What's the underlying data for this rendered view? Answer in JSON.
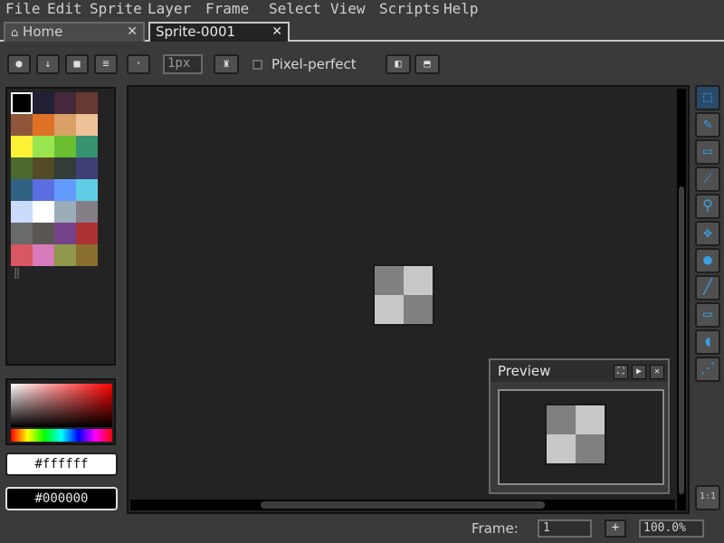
{
  "menu": [
    "File",
    "Edit",
    "Sprite",
    "Layer",
    "Frame",
    "Select",
    "View",
    "Scripts",
    "Help"
  ],
  "tabs": [
    {
      "label": "Home",
      "icon": "home-icon",
      "close": "✕",
      "active": false
    },
    {
      "label": "Sprite-0001",
      "close": "✕",
      "active": true
    }
  ],
  "context_bar": {
    "brush_size": "1px",
    "pixel_perfect_label": "Pixel-perfect",
    "pixel_perfect_checked": false
  },
  "palette": [
    "#000000",
    "#222034",
    "#45283c",
    "#663931",
    "#8f563b",
    "#df7126",
    "#d9a066",
    "#eec39a",
    "#fbf236",
    "#99e550",
    "#6abe30",
    "#37946e",
    "#4b692f",
    "#524b24",
    "#323c39",
    "#3f3f74",
    "#306082",
    "#5b6ee1",
    "#639bff",
    "#5fcde4",
    "#cbdbfc",
    "#ffffff",
    "#9badb7",
    "#847e87",
    "#696a6a",
    "#595652",
    "#76428a",
    "#ac3232",
    "#d95763",
    "#d77bba",
    "#8f974a",
    "#8a6f30"
  ],
  "colors": {
    "foreground": "#ffffff",
    "background": "#000000"
  },
  "preview": {
    "title": "Preview"
  },
  "status": {
    "frame_label": "Frame:",
    "frame_value": "1",
    "add_frame": "+",
    "zoom": "100.0%"
  },
  "tools": [
    "rectangular-marquee-icon",
    "pencil-icon",
    "eraser-icon",
    "eyedropper-icon",
    "zoom-icon",
    "move-icon",
    "paint-bucket-icon",
    "line-icon",
    "rectangle-icon",
    "contour-icon",
    "spray-icon"
  ],
  "reset_zoom_label": "1:1"
}
